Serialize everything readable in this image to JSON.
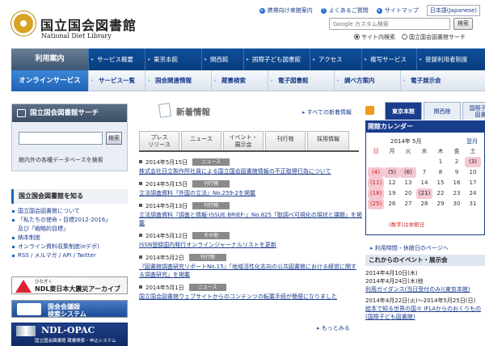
{
  "header": {
    "logo_jp": "国立国会図書館",
    "logo_en": "National Diet Library",
    "top_links": [
      "携帯向け来館案内",
      "よくあるご質問",
      "サイトマップ"
    ],
    "language": "日本語(Japanese)",
    "search_placeholder": "Google カスタム検索",
    "search_button": "検索",
    "scope_options": [
      "サイト内検索",
      "国立国会図書館サーチ"
    ]
  },
  "nav1": {
    "head": "利用案内",
    "items": [
      "サービス概要",
      "東京本館",
      "関西館",
      "国際子ども図書館",
      "アクセス",
      "複写サービス",
      "登録利用者制度"
    ]
  },
  "nav2": {
    "head": "オンラインサービス",
    "items": [
      "サービス一覧",
      "国会関連情報",
      "蔵書検索",
      "電子図書館",
      "調べ方案内",
      "電子展示会"
    ]
  },
  "left": {
    "search_title": "国立国会図書館サーチ",
    "search_button": "検索",
    "search_note": "館内外の各種データベースを検索",
    "know_title": "国立国会図書館を知る",
    "links": [
      "国立国会図書館について",
      "「私たちの使命・目標2012-2016」",
      "及び「戦略的目標」",
      "納本制度",
      "オンライン資料収集制度(eデポ)",
      "RSS / メルマガ / API / Twitter"
    ],
    "banner1_small": "ひなぎく",
    "banner1": "NDL東日本大震災アーカイブ",
    "banner2_line1": "国会会議録",
    "banner2_line2": "検索システム",
    "banner3": "NDL-OPAC",
    "banner3_sub": "国立国会図書館 蔵書検索・申込システム"
  },
  "news": {
    "title": "新着情報",
    "all_link": "すべての新着情報",
    "tabs": [
      "プレス\nリリース",
      "ニュース",
      "イベント・\n展示会",
      "刊行物",
      "採用情報"
    ],
    "items": [
      {
        "date": "2014年5月15日",
        "badge": "ニュース",
        "text": "株式会社日立製作所社員による国立国会図書館情報の不正取得行為について"
      },
      {
        "date": "2014年5月15日",
        "badge": "刊行物",
        "text": "立法調査資料『外国の立法』No.259-2を掲載"
      },
      {
        "date": "2014年5月13日",
        "badge": "刊行物",
        "text": "立法調査資料『調査と情報-ISSUE BRIEF-』No.825「取調べ可視化の現状と課題」を掲載"
      },
      {
        "date": "2014年5月12日",
        "badge": "その他",
        "text": "ISSN登録国内発行オンラインジャーナルリストを更新"
      },
      {
        "date": "2014年5月2日",
        "badge": "刊行物",
        "text": "『図書館調査研究リポートNo.15』「地域活性化志向の公共図書館における経営に関する調査研究」を掲載"
      },
      {
        "date": "2014年5月1日",
        "badge": "ニュース",
        "text": "国立国会図書館ウェブサイトからのコンテンツの転載手続が簡便になりました"
      }
    ],
    "more": "もっとみる"
  },
  "right": {
    "tabs": [
      "東京本館",
      "関西館",
      "国際子ども\n図書館"
    ],
    "cal_title": "開館カレンダー",
    "cal_year_month": "2014年 5月",
    "cal_next": "翌月",
    "weekdays": [
      "日",
      "月",
      "火",
      "水",
      "木",
      "金",
      "土"
    ],
    "weeks": [
      [
        "",
        "",
        "",
        "",
        "1",
        "2",
        "3"
      ],
      [
        "4",
        "5",
        "6",
        "7",
        "8",
        "9",
        "10"
      ],
      [
        "11",
        "12",
        "13",
        "14",
        "15",
        "16",
        "17"
      ],
      [
        "18",
        "19",
        "20",
        "21",
        "22",
        "23",
        "24"
      ],
      [
        "25",
        "26",
        "27",
        "28",
        "29",
        "30",
        "31"
      ]
    ],
    "closed_days": [
      "3",
      "4",
      "5",
      "6",
      "11",
      "18",
      "21",
      "25"
    ],
    "cal_note": "(数字)は休館日",
    "cal_link": "利用時間・休館日のページへ",
    "events_title": "これからのイベント・展示会",
    "events": [
      {
        "date": "2014年4月10日(木)",
        "date2": "2014年4月24日(木)他",
        "text": "利用ガイダンス(当日受付のみ)(東京本館)"
      },
      {
        "date": "2014年4月22日(火)〜2014年5月25日(日)",
        "date2": "",
        "text": "絵本で知る世界の国々 IFLAからのおくりもの(国際子ども図書館)"
      }
    ]
  },
  "colors": {
    "nav_blue": "#0e4e9a",
    "link": "#1a3c8c",
    "holiday_bg": "#f6c8d2"
  }
}
